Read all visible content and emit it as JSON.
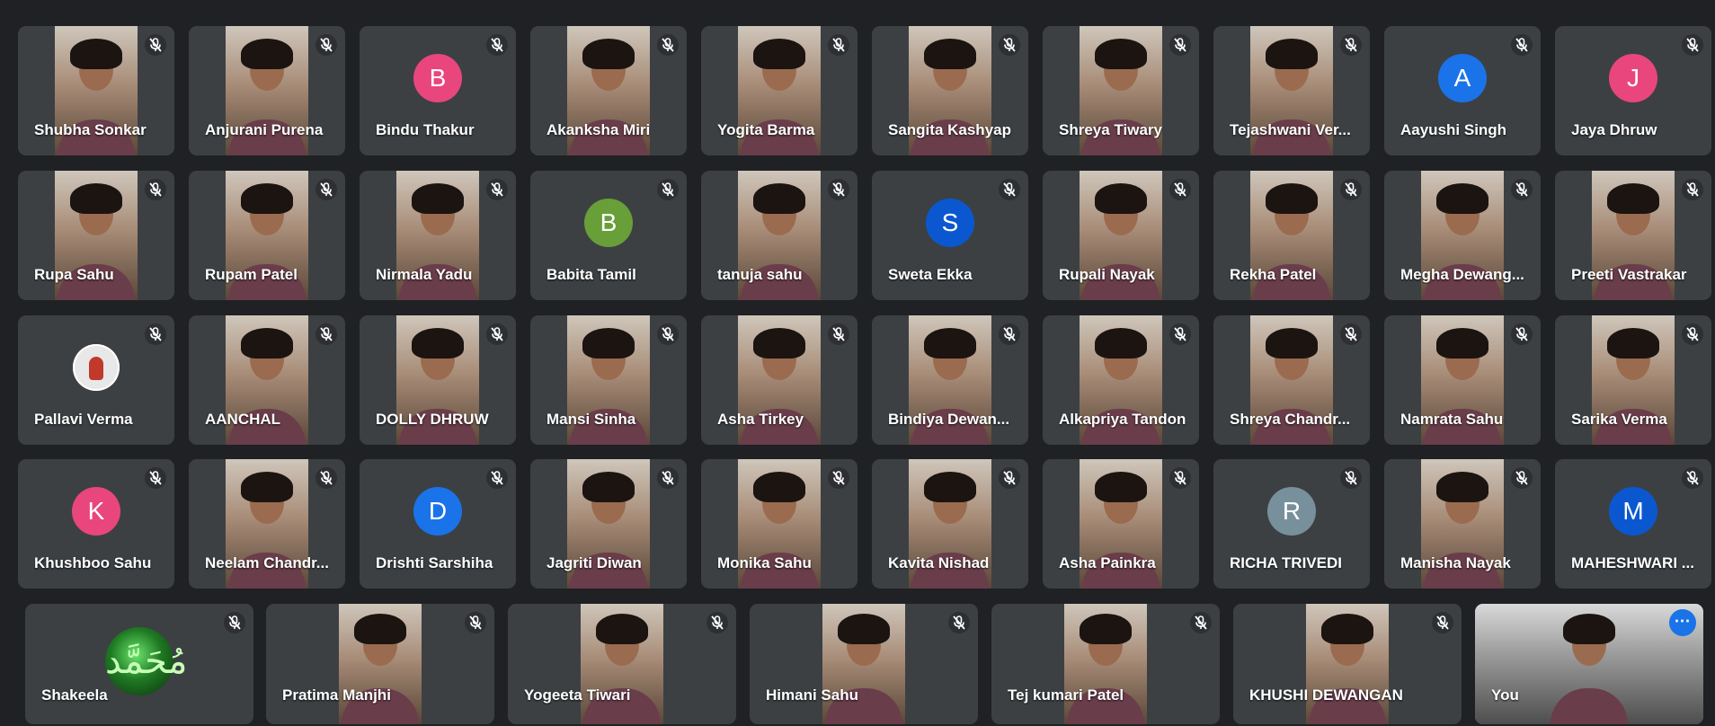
{
  "meeting": {
    "rows": [
      [
        {
          "name": "Shubha Sonkar",
          "type": "video"
        },
        {
          "name": "Anjurani Purena",
          "type": "video"
        },
        {
          "name": "Bindu Thakur",
          "type": "avatar",
          "initial": "B",
          "color": "#e8467c"
        },
        {
          "name": "Akanksha Miri",
          "type": "video"
        },
        {
          "name": "Yogita Barma",
          "type": "video"
        },
        {
          "name": "Sangita Kashyap",
          "type": "video"
        },
        {
          "name": "Shreya Tiwary",
          "type": "video"
        },
        {
          "name": "Tejashwani Ver...",
          "type": "video"
        },
        {
          "name": "Aayushi Singh",
          "type": "avatar",
          "initial": "A",
          "color": "#1a73e8"
        },
        {
          "name": "Jaya Dhruw",
          "type": "avatar",
          "initial": "J",
          "color": "#e8467c"
        }
      ],
      [
        {
          "name": "Rupa Sahu",
          "type": "video"
        },
        {
          "name": "Rupam Patel",
          "type": "video"
        },
        {
          "name": "Nirmala Yadu",
          "type": "video"
        },
        {
          "name": "Babita Tamil",
          "type": "avatar",
          "initial": "B",
          "color": "#689f38"
        },
        {
          "name": "tanuja sahu",
          "type": "video"
        },
        {
          "name": "Sweta Ekka",
          "type": "avatar",
          "initial": "S",
          "color": "#0b57d0"
        },
        {
          "name": "Rupali Nayak",
          "type": "video"
        },
        {
          "name": "Rekha Patel",
          "type": "video"
        },
        {
          "name": "Megha Dewang...",
          "type": "video"
        },
        {
          "name": "Preeti Vastrakar",
          "type": "video"
        }
      ],
      [
        {
          "name": "Pallavi Verma",
          "type": "photo"
        },
        {
          "name": "AANCHAL",
          "type": "video"
        },
        {
          "name": "DOLLY DHRUW",
          "type": "video"
        },
        {
          "name": "Mansi Sinha",
          "type": "video"
        },
        {
          "name": "Asha Tirkey",
          "type": "video"
        },
        {
          "name": "Bindiya Dewan...",
          "type": "video"
        },
        {
          "name": "Alkapriya Tandon",
          "type": "video"
        },
        {
          "name": "Shreya Chandr...",
          "type": "video"
        },
        {
          "name": "Namrata Sahu",
          "type": "video"
        },
        {
          "name": "Sarika Verma",
          "type": "video"
        }
      ],
      [
        {
          "name": "Khushboo Sahu",
          "type": "avatar",
          "initial": "K",
          "color": "#e8467c"
        },
        {
          "name": "Neelam Chandr...",
          "type": "video"
        },
        {
          "name": "Drishti Sarshiha",
          "type": "avatar",
          "initial": "D",
          "color": "#1a73e8"
        },
        {
          "name": "Jagriti Diwan",
          "type": "video"
        },
        {
          "name": "Monika Sahu",
          "type": "video"
        },
        {
          "name": "Kavita Nishad",
          "type": "video"
        },
        {
          "name": "Asha Painkra",
          "type": "video"
        },
        {
          "name": "RICHA TRIVEDI",
          "type": "avatar",
          "initial": "R",
          "color": "#78909c"
        },
        {
          "name": "Manisha Nayak",
          "type": "video"
        },
        {
          "name": "MAHESHWARI ...",
          "type": "avatar",
          "initial": "M",
          "color": "#0b57d0"
        }
      ],
      [
        {
          "name": "Shakeela",
          "type": "emblem"
        },
        {
          "name": "Pratima Manjhi",
          "type": "video"
        },
        {
          "name": "Yogeeta Tiwari",
          "type": "video"
        },
        {
          "name": "Himani Sahu",
          "type": "video"
        },
        {
          "name": "Tej kumari Patel",
          "type": "video"
        },
        {
          "name": "KHUSHI DEWANGAN",
          "type": "video"
        },
        {
          "name": "You",
          "type": "video",
          "self": true
        }
      ]
    ]
  },
  "icons": {
    "mic_off": "microphone-off-icon",
    "more": "more-options-icon",
    "emblem_glyph": "مُحَمَّد"
  }
}
